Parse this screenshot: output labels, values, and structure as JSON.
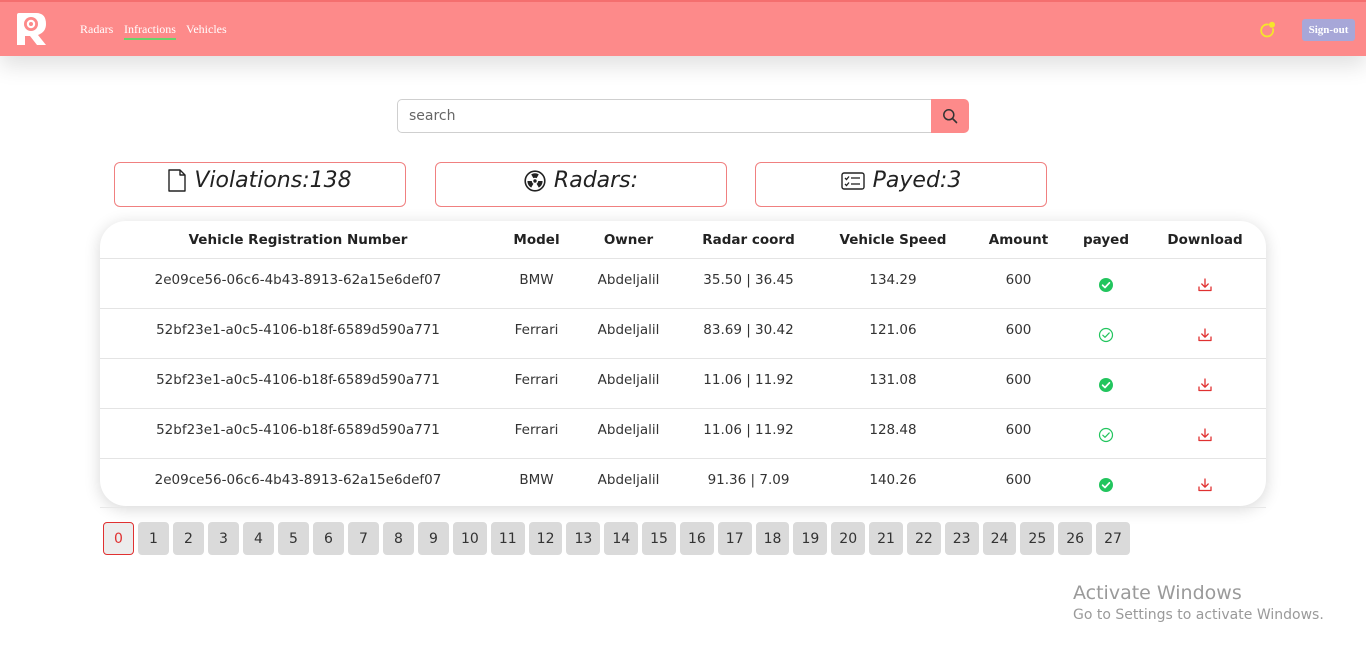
{
  "app": {
    "nav": [
      {
        "label": "Radars"
      },
      {
        "label": "Infractions",
        "active": true
      },
      {
        "label": "Vehicles"
      }
    ],
    "signout_label": "Sign-out"
  },
  "search": {
    "placeholder": "search",
    "value": ""
  },
  "stats": {
    "violations": "Violations:138",
    "radars": "Radars:",
    "payed": "Payed:3"
  },
  "table": {
    "headers": [
      "Vehicle Registration Number",
      "Model",
      "Owner",
      "Radar coord",
      "Vehicle Speed",
      "Amount",
      "payed",
      "Download"
    ],
    "rows": [
      {
        "reg": "2e09ce56-06c6-4b43-8913-62a15e6def07",
        "model": "BMW",
        "owner": "Abdeljalil",
        "coord": "35.50 | 36.45",
        "speed": "134.29",
        "amount": "600",
        "payed_icon": "check-circle-filled-icon",
        "download_icon": "download-icon"
      },
      {
        "reg": "52bf23e1-a0c5-4106-b18f-6589d590a771",
        "model": "Ferrari",
        "owner": "Abdeljalil",
        "coord": "83.69 | 30.42",
        "speed": "121.06",
        "amount": "600",
        "payed_icon": "check-circle-outline-icon",
        "download_icon": "download-icon"
      },
      {
        "reg": "52bf23e1-a0c5-4106-b18f-6589d590a771",
        "model": "Ferrari",
        "owner": "Abdeljalil",
        "coord": "11.06 | 11.92",
        "speed": "131.08",
        "amount": "600",
        "payed_icon": "check-circle-filled-icon",
        "download_icon": "download-icon"
      },
      {
        "reg": "52bf23e1-a0c5-4106-b18f-6589d590a771",
        "model": "Ferrari",
        "owner": "Abdeljalil",
        "coord": "11.06 | 11.92",
        "speed": "128.48",
        "amount": "600",
        "payed_icon": "check-circle-outline-icon",
        "download_icon": "download-icon"
      },
      {
        "reg": "2e09ce56-06c6-4b43-8913-62a15e6def07",
        "model": "BMW",
        "owner": "Abdeljalil",
        "coord": "91.36 | 7.09",
        "speed": "140.26",
        "amount": "600",
        "payed_icon": "check-circle-filled-icon",
        "download_icon": "download-icon"
      }
    ]
  },
  "pagination": {
    "pages": [
      "0",
      "1",
      "2",
      "3",
      "4",
      "5",
      "6",
      "7",
      "8",
      "9",
      "10",
      "11",
      "12",
      "13",
      "14",
      "15",
      "16",
      "17",
      "18",
      "19",
      "20",
      "21",
      "22",
      "23",
      "24",
      "25",
      "26",
      "27"
    ],
    "current": "0"
  },
  "watermark": {
    "title": "Activate Windows",
    "subtitle": "Go to Settings to activate Windows."
  },
  "colors": {
    "navbar": "#fd8a8a",
    "accent_red": "#e03131",
    "paid_green": "#22c55e",
    "signout": "#a7a7d8",
    "notification": "#f5e52a"
  }
}
